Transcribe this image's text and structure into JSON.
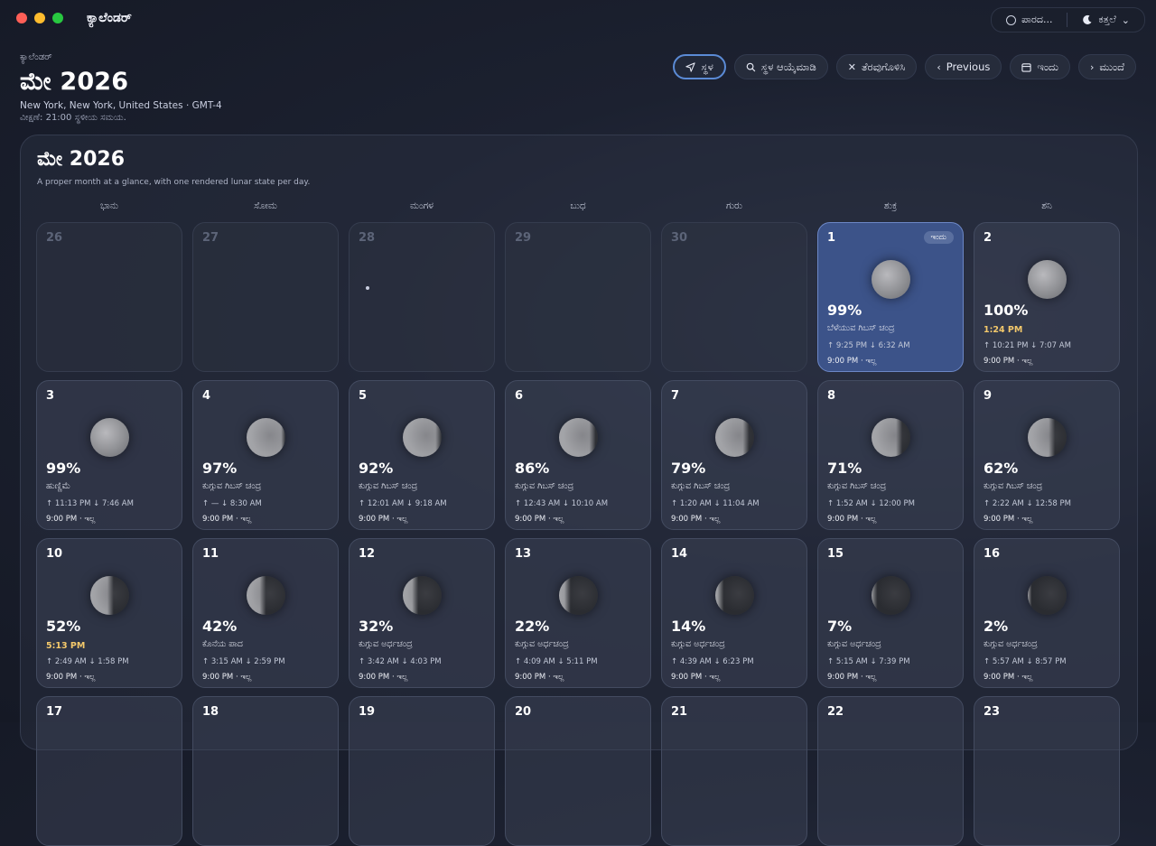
{
  "app": {
    "title": "ಕ್ಯಾಲೆಂಡರ್"
  },
  "top_controls": {
    "mode_label": "ಪಾರದ...",
    "theme_label": "ಕತ್ತಲೆ"
  },
  "header": {
    "small": "ಕ್ಯಾಲೆಂಡರ್",
    "title": "ಮೇ 2026",
    "location": "New York, New York, United States · GMT-4",
    "note": "ವೀಕ್ಷಣೆ: 21:00 ಸ್ಥಳೀಯ ಸಮಯ."
  },
  "toolbar": {
    "location_label": "ಸ್ಥಳ",
    "choose_location_label": "ಸ್ಥಳ ಆಯ್ಕೆಮಾಡಿ",
    "clear_label": "ತೆರವುಗೊಳಿಸಿ",
    "previous_label": "Previous",
    "today_label": "ಇಂದು",
    "next_label": "ಮುಂದೆ"
  },
  "panel": {
    "title": "ಮೇ 2026",
    "subtitle": "A proper month at a glance, with one rendered lunar state per day."
  },
  "weekdays": [
    "ಭಾನು",
    "ಸೋಮ",
    "ಮಂಗಳ",
    "ಬುಧ",
    "ಗುರು",
    "ಶುಕ್ರ",
    "ಶನಿ"
  ],
  "today_badge": "ಇಂದು",
  "days": [
    {
      "num": "26",
      "empty": true
    },
    {
      "num": "27",
      "empty": true
    },
    {
      "num": "28",
      "empty": true,
      "dot": true
    },
    {
      "num": "29",
      "empty": true
    },
    {
      "num": "30",
      "empty": true
    },
    {
      "num": "1",
      "today": true,
      "illum": 0.99,
      "waning": false,
      "pct": "99%",
      "phase": "ಬೆಳೆಯುವ ಗಿಬಸ್ ಚಂದ್ರ",
      "rise": "↑ 9:25 PM  ↓ 6:32 AM",
      "foot": "9:00 PM · ಇಲ್ಲ"
    },
    {
      "num": "2",
      "illum": 1.0,
      "waning": false,
      "pct": "100%",
      "time": "1:24 PM",
      "rise": "↑ 10:21 PM  ↓ 7:07 AM",
      "foot": "9:00 PM · ಇಲ್ಲ"
    },
    {
      "num": "3",
      "illum": 0.99,
      "waning": true,
      "pct": "99%",
      "phase": "ಹುಣ್ಣಿಮೆ",
      "rise": "↑ 11:13 PM  ↓ 7:46 AM",
      "foot": "9:00 PM · ಇಲ್ಲ"
    },
    {
      "num": "4",
      "illum": 0.97,
      "waning": true,
      "pct": "97%",
      "phase": "ಕುಗ್ಗುವ ಗಿಬಸ್ ಚಂದ್ರ",
      "rise": "↑ —  ↓ 8:30 AM",
      "foot": "9:00 PM · ಇಲ್ಲ"
    },
    {
      "num": "5",
      "illum": 0.92,
      "waning": true,
      "pct": "92%",
      "phase": "ಕುಗ್ಗುವ ಗಿಬಸ್ ಚಂದ್ರ",
      "rise": "↑ 12:01 AM  ↓ 9:18 AM",
      "foot": "9:00 PM · ಇಲ್ಲ"
    },
    {
      "num": "6",
      "illum": 0.86,
      "waning": true,
      "pct": "86%",
      "phase": "ಕುಗ್ಗುವ ಗಿಬಸ್ ಚಂದ್ರ",
      "rise": "↑ 12:43 AM  ↓ 10:10 AM",
      "foot": "9:00 PM · ಇಲ್ಲ"
    },
    {
      "num": "7",
      "illum": 0.79,
      "waning": true,
      "pct": "79%",
      "phase": "ಕುಗ್ಗುವ ಗಿಬಸ್ ಚಂದ್ರ",
      "rise": "↑ 1:20 AM  ↓ 11:04 AM",
      "foot": "9:00 PM · ಇಲ್ಲ"
    },
    {
      "num": "8",
      "illum": 0.71,
      "waning": true,
      "pct": "71%",
      "phase": "ಕುಗ್ಗುವ ಗಿಬಸ್ ಚಂದ್ರ",
      "rise": "↑ 1:52 AM  ↓ 12:00 PM",
      "foot": "9:00 PM · ಇಲ್ಲ"
    },
    {
      "num": "9",
      "illum": 0.62,
      "waning": true,
      "pct": "62%",
      "phase": "ಕುಗ್ಗುವ ಗಿಬಸ್ ಚಂದ್ರ",
      "rise": "↑ 2:22 AM  ↓ 12:58 PM",
      "foot": "9:00 PM · ಇಲ್ಲ"
    },
    {
      "num": "10",
      "illum": 0.52,
      "waning": true,
      "pct": "52%",
      "time": "5:13 PM",
      "rise": "↑ 2:49 AM  ↓ 1:58 PM",
      "foot": "9:00 PM · ಇಲ್ಲ"
    },
    {
      "num": "11",
      "illum": 0.42,
      "waning": true,
      "pct": "42%",
      "phase": "ಕೊನೆಯ ಪಾದ",
      "rise": "↑ 3:15 AM  ↓ 2:59 PM",
      "foot": "9:00 PM · ಇಲ್ಲ"
    },
    {
      "num": "12",
      "illum": 0.32,
      "waning": true,
      "pct": "32%",
      "phase": "ಕುಗ್ಗುವ ಅರ್ಧಚಂದ್ರ",
      "rise": "↑ 3:42 AM  ↓ 4:03 PM",
      "foot": "9:00 PM · ಇಲ್ಲ"
    },
    {
      "num": "13",
      "illum": 0.22,
      "waning": true,
      "pct": "22%",
      "phase": "ಕುಗ್ಗುವ ಅರ್ಧಚಂದ್ರ",
      "rise": "↑ 4:09 AM  ↓ 5:11 PM",
      "foot": "9:00 PM · ಇಲ್ಲ"
    },
    {
      "num": "14",
      "illum": 0.14,
      "waning": true,
      "pct": "14%",
      "phase": "ಕುಗ್ಗುವ ಅರ್ಧಚಂದ್ರ",
      "rise": "↑ 4:39 AM  ↓ 6:23 PM",
      "foot": "9:00 PM · ಇಲ್ಲ"
    },
    {
      "num": "15",
      "illum": 0.07,
      "waning": true,
      "pct": "7%",
      "phase": "ಕುಗ್ಗುವ ಅರ್ಧಚಂದ್ರ",
      "rise": "↑ 5:15 AM  ↓ 7:39 PM",
      "foot": "9:00 PM · ಇಲ್ಲ"
    },
    {
      "num": "16",
      "illum": 0.02,
      "waning": true,
      "pct": "2%",
      "phase": "ಕುಗ್ಗುವ ಅರ್ಧಚಂದ್ರ",
      "rise": "↑ 5:57 AM  ↓ 8:57 PM",
      "foot": "9:00 PM · ಇಲ್ಲ"
    },
    {
      "num": "17",
      "partial": true
    },
    {
      "num": "18",
      "partial": true
    },
    {
      "num": "19",
      "partial": true
    },
    {
      "num": "20",
      "partial": true
    },
    {
      "num": "21",
      "partial": true
    },
    {
      "num": "22",
      "partial": true
    },
    {
      "num": "23",
      "partial": true
    }
  ]
}
